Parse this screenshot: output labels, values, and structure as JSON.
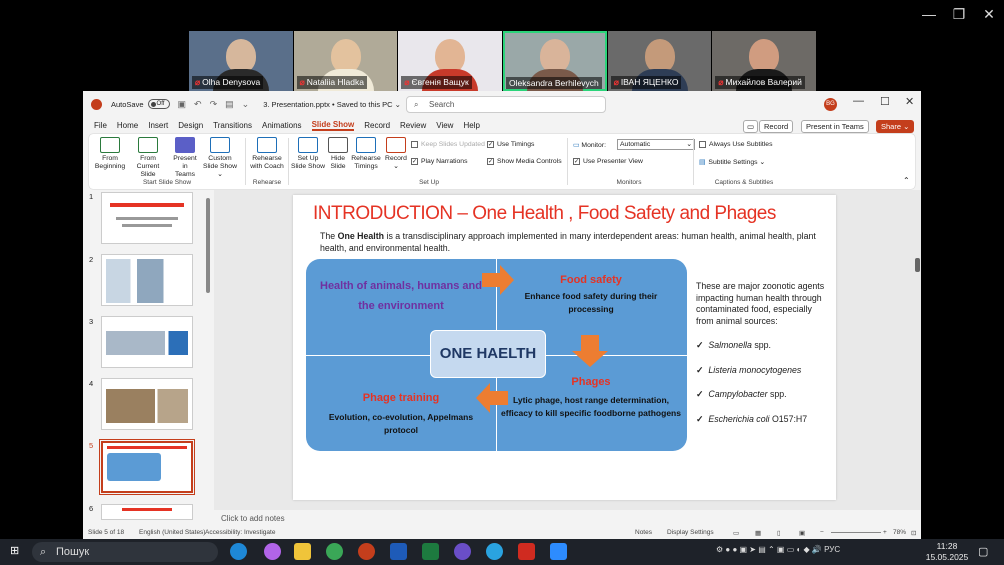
{
  "zoom_window": {
    "controls": [
      "—",
      "❐",
      "✕"
    ]
  },
  "participants": [
    {
      "name": "Olha Denysova",
      "mic_muted": true,
      "face": "#d6b79c",
      "body": "#2a2a2a",
      "bg": "#5a6f8a"
    },
    {
      "name": "Nataliia Hladka",
      "mic_muted": true,
      "face": "#e3c29e",
      "body": "#f0ead8",
      "bg": "#b0aa98"
    },
    {
      "name": "Євгенія Ващук",
      "mic_muted": true,
      "face": "#e2b594",
      "body": "#c83a2a",
      "bg": "#e9e7ec"
    },
    {
      "name": "Oleksandra Berhilevych",
      "mic_muted": false,
      "face": "#d9b49a",
      "body": "#7a5a4a",
      "bg": "#9aa8a8"
    },
    {
      "name": "IВАН ЯЦЕНКО",
      "mic_muted": true,
      "face": "#c49a7a",
      "body": "#2e3d55",
      "bg": "#6a6a6a"
    },
    {
      "name": "Михайлов Валерий",
      "mic_muted": true,
      "face": "#d09c80",
      "body": "#1a1a1a",
      "bg": "#6d6a66"
    }
  ],
  "ppt": {
    "autosave": "AutoSave",
    "toggle": "Off",
    "filename": "3. Presentation.pptx • Saved to this PC ⌄",
    "search_placeholder": "Search",
    "avatar": "BG",
    "menu": [
      "File",
      "Home",
      "Insert",
      "Design",
      "Transitions",
      "Animations",
      "Slide Show",
      "Record",
      "Review",
      "View",
      "Help"
    ],
    "record_btn": "Record",
    "present_teams_btn": "Present in Teams",
    "share_btn": "Share ⌄",
    "ribbon": {
      "buttons": [
        {
          "label": "From Beginning"
        },
        {
          "label": "From Current Slide"
        },
        {
          "label": "Present in Teams"
        },
        {
          "label": "Custom Slide Show ⌄"
        },
        {
          "label": "Rehearse with Coach"
        },
        {
          "label": "Set Up Slide Show"
        },
        {
          "label": "Hide Slide"
        },
        {
          "label": "Rehearse Timings"
        },
        {
          "label": "Record ⌄"
        }
      ],
      "checks": {
        "keep_updated": "Keep Slides Updated",
        "use_timings": "Use Timings",
        "play_narrations": "Play Narrations",
        "show_media": "Show Media Controls",
        "monitor_label": "Monitor:",
        "monitor_value": "Automatic",
        "presenter_view": "Use Presenter View",
        "always_subtitles": "Always Use Subtitles",
        "subtitle_settings": "Subtitle Settings ⌄"
      },
      "groups": [
        "Start Slide Show",
        "Rehearse",
        "Set Up",
        "Monitors",
        "Captions & Subtitles"
      ]
    },
    "thumbnails": [
      "1",
      "2",
      "3",
      "4",
      "5",
      "6"
    ],
    "slide": {
      "title": "INTRODUCTION – One Health , Food Safety and Phages",
      "intro_pre": "The ",
      "intro_bold": "One Health",
      "intro_post": " is a transdisciplinary approach implemented in many interdependent areas: human health, animal health, plant health, and environmental health.",
      "center": "ONE HAELTH",
      "tl": "Health of animals, humans and the environment",
      "tr_title": "Food safety",
      "tr_body": "Enhance food safety during their processing",
      "bl_title": "Phage training",
      "bl_body": "Evolution, co-evolution, Appelmans protocol",
      "br_title": "Phages",
      "br_body": "Lytic phage, host range determination, efficacy to kill specific foodborne pathogens",
      "zoonotic_text": "These are major zoonotic agents impacting human health through contaminated food, especially from animal sources:",
      "pathogens": [
        {
          "italic": "Salmonella",
          "rest": " spp."
        },
        {
          "italic": "Listeria monocytogenes",
          "rest": ""
        },
        {
          "italic": "Campylobacter",
          "rest": " spp."
        },
        {
          "italic": "Escherichia coli",
          "rest": " O157:H7"
        }
      ]
    },
    "notes_placeholder": "Click to add notes",
    "status": {
      "slide": "Slide 5 of 18",
      "language": "English (United States)",
      "accessibility": "Accessibility: Investigate",
      "notes": "Notes",
      "display": "Display Settings",
      "zoom": "78%"
    }
  },
  "taskbar": {
    "search": "Пошук",
    "lang": "РУС",
    "time": "11:28",
    "date": "15.05.2025"
  }
}
